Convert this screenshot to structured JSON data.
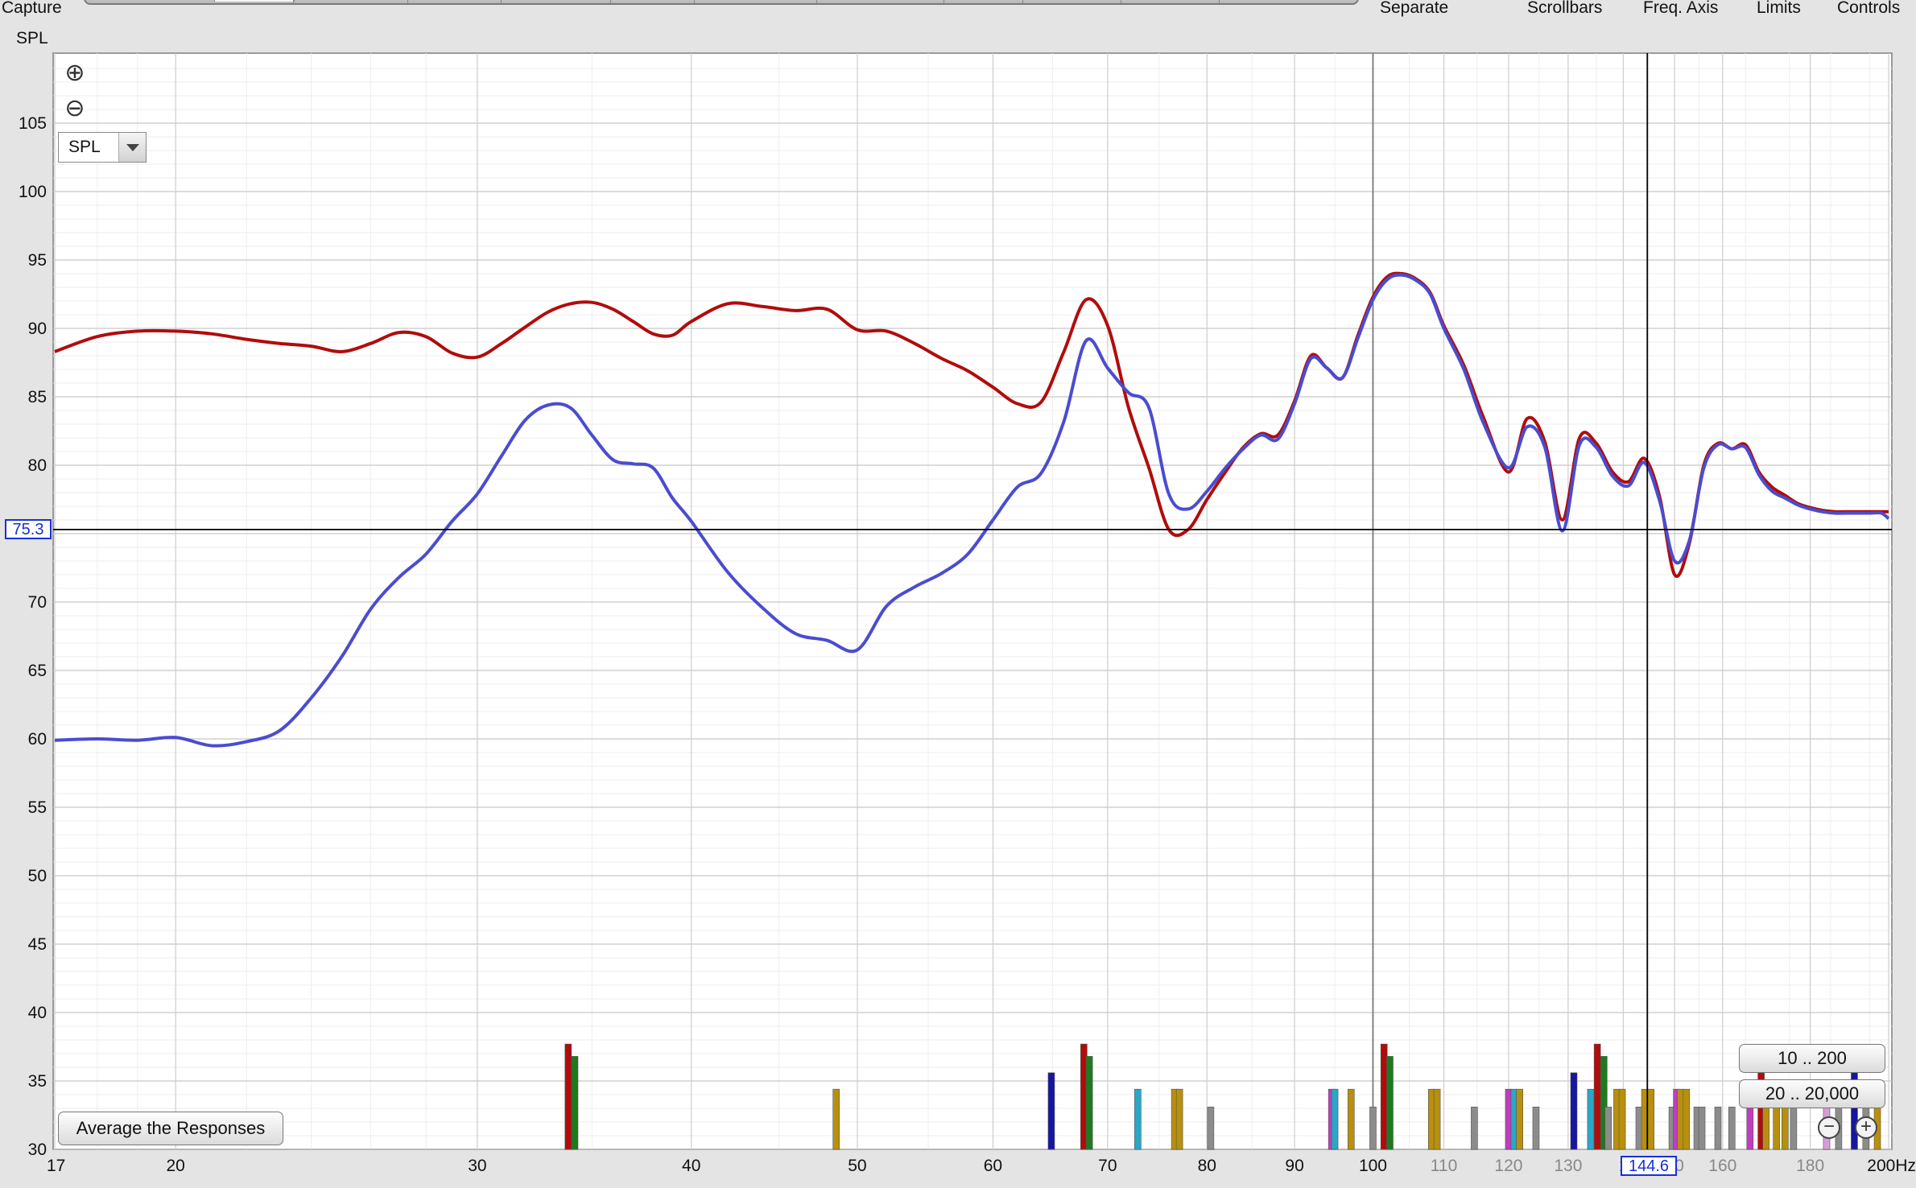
{
  "top_menu": {
    "capture": "Capture",
    "separate": "Separate",
    "scrollbars": "Scrollbars",
    "freq_axis": "Freq. Axis",
    "limits": "Limits",
    "controls": "Controls"
  },
  "controls": {
    "y_unit": "SPL",
    "spl_select_value": "SPL",
    "average_button": "Average the Responses",
    "range_button_1": "10 .. 200",
    "range_button_2": "20 .. 20,000",
    "cursor_y_readout": "75.3",
    "cursor_x_readout": "144.6"
  },
  "icons": {
    "zoom_in": "zoom-in-icon",
    "zoom_out": "zoom-out-icon",
    "dropdown": "chevron-down-icon"
  },
  "colors": {
    "background": "#e4e4e4",
    "plot_background": "#ffffff",
    "red_trace": "#b10c0c",
    "blue_trace": "#4a4cd0",
    "cursor": "#000000",
    "readout": "#1a2fd8"
  },
  "chart_data": {
    "type": "line",
    "x_scale": "log",
    "xlim": [
      17,
      200
    ],
    "ylim": [
      30,
      110
    ],
    "ylabel": "SPL",
    "y_ticks": [
      30,
      35,
      40,
      45,
      50,
      55,
      60,
      65,
      70,
      75,
      80,
      85,
      90,
      95,
      100,
      105
    ],
    "x_ticks": [
      {
        "v": 17,
        "label": "17"
      },
      {
        "v": 20,
        "label": "20"
      },
      {
        "v": 30,
        "label": "30"
      },
      {
        "v": 40,
        "label": "40"
      },
      {
        "v": 50,
        "label": "50"
      },
      {
        "v": 60,
        "label": "60"
      },
      {
        "v": 70,
        "label": "70"
      },
      {
        "v": 80,
        "label": "80"
      },
      {
        "v": 90,
        "label": "90"
      },
      {
        "v": 100,
        "label": "100"
      },
      {
        "v": 110,
        "label": "110",
        "grey": true
      },
      {
        "v": 120,
        "label": "120",
        "grey": true
      },
      {
        "v": 130,
        "label": "130",
        "grey": true
      },
      {
        "v": 140,
        "label": "1",
        "grey": true
      },
      {
        "v": 150,
        "label": "50",
        "grey": true
      },
      {
        "v": 160,
        "label": "160",
        "grey": true
      },
      {
        "v": 180,
        "label": "180",
        "grey": true
      },
      {
        "v": 200,
        "label": "200Hz"
      }
    ],
    "cursor": {
      "x": 144.6,
      "y": 75.3
    },
    "series": [
      {
        "color": "#b10c0c",
        "x": [
          17,
          18,
          19,
          20,
          21,
          22,
          23,
          24,
          25,
          26,
          27,
          28,
          29,
          30,
          31,
          32,
          33,
          34,
          35,
          36,
          37,
          38,
          39,
          40,
          42,
          44,
          46,
          48,
          50,
          52,
          54,
          56,
          58,
          60,
          62,
          64,
          66,
          68,
          70,
          72,
          74,
          76,
          78,
          80,
          82,
          84,
          86,
          88,
          90,
          92,
          94,
          96,
          98,
          100,
          102,
          104,
          106,
          108,
          110,
          113,
          116,
          120,
          123,
          126,
          129,
          132,
          135,
          138,
          141,
          144,
          147,
          150,
          153,
          156,
          159,
          162,
          165,
          168,
          171,
          174,
          177,
          180,
          183,
          186,
          189,
          192,
          195,
          198,
          200
        ],
        "y": [
          88.3,
          89.4,
          89.8,
          89.8,
          89.6,
          89.2,
          88.9,
          88.7,
          88.3,
          88.9,
          89.7,
          89.4,
          88.2,
          87.9,
          88.9,
          90.1,
          91.2,
          91.8,
          91.9,
          91.4,
          90.5,
          89.6,
          89.5,
          90.5,
          91.8,
          91.6,
          91.3,
          91.4,
          89.9,
          89.8,
          88.9,
          87.8,
          86.9,
          85.7,
          84.5,
          84.6,
          88.3,
          92.1,
          90.2,
          84.2,
          79.8,
          75.3,
          75.3,
          77.5,
          79.5,
          81.3,
          82.3,
          82.2,
          84.7,
          88.0,
          87.1,
          86.4,
          89.5,
          92.3,
          93.8,
          94.0,
          93.6,
          92.6,
          90.2,
          87.3,
          83.5,
          79.5,
          83.4,
          81.7,
          76.0,
          82.0,
          81.6,
          79.5,
          78.8,
          80.5,
          77.7,
          72.0,
          74.3,
          80.0,
          81.6,
          81.2,
          81.5,
          79.5,
          78.4,
          77.8,
          77.2,
          76.9,
          76.7,
          76.6,
          76.6,
          76.6,
          76.6,
          76.6,
          76.6
        ]
      },
      {
        "color": "#4a4cd0",
        "x": [
          17,
          18,
          19,
          20,
          21,
          22,
          23,
          24,
          25,
          26,
          27,
          28,
          29,
          30,
          31,
          32,
          33,
          34,
          35,
          36,
          37,
          38,
          39,
          40,
          42,
          44,
          46,
          48,
          50,
          52,
          54,
          56,
          58,
          60,
          62,
          64,
          66,
          68,
          70,
          72,
          74,
          76,
          78,
          80,
          82,
          84,
          86,
          88,
          90,
          92,
          94,
          96,
          98,
          100,
          102,
          104,
          106,
          108,
          110,
          113,
          116,
          120,
          123,
          126,
          129,
          132,
          135,
          138,
          141,
          144,
          147,
          150,
          153,
          156,
          159,
          162,
          165,
          168,
          171,
          174,
          177,
          180,
          183,
          186,
          189,
          192,
          195,
          198,
          200
        ],
        "y": [
          59.9,
          60.0,
          59.9,
          60.1,
          59.5,
          59.8,
          60.6,
          63.0,
          66.0,
          69.5,
          71.8,
          73.5,
          75.9,
          77.9,
          80.7,
          83.3,
          84.4,
          84.2,
          82.2,
          80.4,
          80.1,
          79.8,
          77.6,
          75.9,
          72.2,
          69.6,
          67.7,
          67.2,
          66.5,
          69.7,
          71.1,
          72.1,
          73.5,
          76.0,
          78.4,
          79.4,
          83.2,
          89.1,
          87.1,
          85.3,
          84.2,
          77.9,
          76.8,
          78.1,
          79.8,
          81.2,
          82.2,
          81.9,
          84.5,
          87.8,
          87.1,
          86.4,
          89.3,
          92.1,
          93.6,
          93.9,
          93.5,
          92.5,
          90.0,
          87.0,
          83.1,
          79.8,
          82.8,
          81.3,
          75.2,
          81.5,
          81.3,
          79.2,
          78.5,
          80.2,
          77.4,
          73.0,
          74.5,
          79.8,
          81.5,
          81.2,
          81.3,
          79.3,
          78.1,
          77.6,
          77.1,
          76.8,
          76.6,
          76.5,
          76.5,
          76.5,
          76.5,
          76.5,
          76.1
        ]
      }
    ],
    "filter_markers": [
      {
        "x": 33.9,
        "h": 37.7,
        "c": "#b10c0c"
      },
      {
        "x": 34.2,
        "h": 36.8,
        "c": "#1d7a1d"
      },
      {
        "x": 48.6,
        "h": 34.4,
        "c": "#b8900e"
      },
      {
        "x": 64.9,
        "h": 35.6,
        "c": "#1616a0"
      },
      {
        "x": 67.8,
        "h": 37.7,
        "c": "#b10c0c"
      },
      {
        "x": 68.3,
        "h": 36.8,
        "c": "#1d7a1d"
      },
      {
        "x": 72.9,
        "h": 34.4,
        "c": "#2aa7c7"
      },
      {
        "x": 76.6,
        "h": 34.4,
        "c": "#b8900e"
      },
      {
        "x": 77.1,
        "h": 34.4,
        "c": "#b8900e"
      },
      {
        "x": 80.4,
        "h": 33.1,
        "c": "#8c8c8c"
      },
      {
        "x": 94.6,
        "h": 34.4,
        "c": "#c13cc1"
      },
      {
        "x": 95.0,
        "h": 34.4,
        "c": "#2aa7c7"
      },
      {
        "x": 97.1,
        "h": 34.4,
        "c": "#b8900e"
      },
      {
        "x": 100.0,
        "h": 33.1,
        "c": "#8c8c8c"
      },
      {
        "x": 101.5,
        "h": 37.7,
        "c": "#b10c0c"
      },
      {
        "x": 102.3,
        "h": 36.8,
        "c": "#1d7a1d"
      },
      {
        "x": 108.2,
        "h": 34.4,
        "c": "#b8900e"
      },
      {
        "x": 109.0,
        "h": 34.4,
        "c": "#b8900e"
      },
      {
        "x": 114.6,
        "h": 33.1,
        "c": "#8c8c8c"
      },
      {
        "x": 120.0,
        "h": 34.4,
        "c": "#c13cc1"
      },
      {
        "x": 120.9,
        "h": 34.4,
        "c": "#2aa7c7"
      },
      {
        "x": 121.8,
        "h": 34.4,
        "c": "#b8900e"
      },
      {
        "x": 124.5,
        "h": 33.1,
        "c": "#8c8c8c"
      },
      {
        "x": 131.0,
        "h": 35.6,
        "c": "#1616a0"
      },
      {
        "x": 134.0,
        "h": 34.4,
        "c": "#2aa7c7"
      },
      {
        "x": 135.2,
        "h": 37.7,
        "c": "#b10c0c"
      },
      {
        "x": 136.4,
        "h": 36.8,
        "c": "#1d7a1d"
      },
      {
        "x": 137.2,
        "h": 33.1,
        "c": "#8c8c8c"
      },
      {
        "x": 138.8,
        "h": 34.4,
        "c": "#b8900e"
      },
      {
        "x": 139.8,
        "h": 34.4,
        "c": "#b8900e"
      },
      {
        "x": 143.0,
        "h": 33.1,
        "c": "#8c8c8c"
      },
      {
        "x": 144.1,
        "h": 34.4,
        "c": "#b8900e"
      },
      {
        "x": 145.3,
        "h": 34.4,
        "c": "#b8900e"
      },
      {
        "x": 149.5,
        "h": 33.1,
        "c": "#8c8c8c"
      },
      {
        "x": 150.4,
        "h": 34.4,
        "c": "#c13cc1"
      },
      {
        "x": 151.2,
        "h": 34.4,
        "c": "#b8900e"
      },
      {
        "x": 152.4,
        "h": 34.4,
        "c": "#b8900e"
      },
      {
        "x": 154.6,
        "h": 33.1,
        "c": "#8c8c8c"
      },
      {
        "x": 155.6,
        "h": 33.1,
        "c": "#8c8c8c"
      },
      {
        "x": 159.0,
        "h": 33.1,
        "c": "#8c8c8c"
      },
      {
        "x": 162.0,
        "h": 33.1,
        "c": "#8c8c8c"
      },
      {
        "x": 166.0,
        "h": 34.4,
        "c": "#c13cc1"
      },
      {
        "x": 168.5,
        "h": 35.6,
        "c": "#b10c0c"
      },
      {
        "x": 169.6,
        "h": 34.4,
        "c": "#b8900e"
      },
      {
        "x": 172.0,
        "h": 34.4,
        "c": "#b8900e"
      },
      {
        "x": 174.0,
        "h": 34.4,
        "c": "#b8900e"
      },
      {
        "x": 176.0,
        "h": 33.1,
        "c": "#8c8c8c"
      },
      {
        "x": 184.0,
        "h": 33.1,
        "c": "#d99bd9"
      },
      {
        "x": 187.0,
        "h": 33.1,
        "c": "#8c8c8c"
      },
      {
        "x": 191.0,
        "h": 35.6,
        "c": "#1616a0"
      },
      {
        "x": 194.0,
        "h": 33.1,
        "c": "#8c8c8c"
      },
      {
        "x": 197.0,
        "h": 34.4,
        "c": "#b8900e"
      }
    ]
  }
}
